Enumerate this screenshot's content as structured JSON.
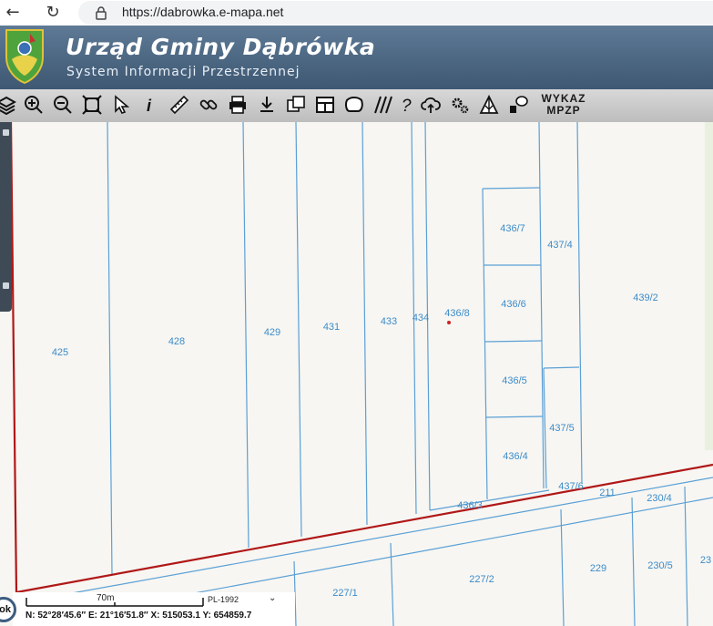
{
  "browser": {
    "url": "https://dabrowka.e-mapa.net"
  },
  "header": {
    "title": "Urząd Gminy Dąbrówka",
    "subtitle": "System Informacji Przestrzennej"
  },
  "toolbar": {
    "tools": [
      "layers-icon",
      "zoom-in-icon",
      "zoom-out-icon",
      "zoom-extent-icon",
      "pointer-icon",
      "info-icon",
      "measure-distance-icon",
      "link-icon",
      "print-icon",
      "download-icon",
      "overview-icon",
      "layout-icon",
      "area-icon",
      "hatch-icon",
      "help-icon",
      "cloud-upload-icon",
      "settings-icon",
      "terrain-icon",
      "comment-icon"
    ],
    "wykaz_line1": "WYKAZ",
    "wykaz_line2": "MPZP"
  },
  "map": {
    "parcels": [
      "425",
      "428",
      "429",
      "431",
      "433",
      "434",
      "436/8",
      "436/7",
      "436/6",
      "436/5",
      "436/4",
      "437/4",
      "437/5",
      "437/6",
      "436/3",
      "439/2",
      "211",
      "230/4",
      "227/1",
      "227/2",
      "229",
      "230/5",
      "23"
    ],
    "colors": {
      "parcel_line": "#5ba0d6",
      "parcel_label": "#3d8cc9",
      "boundary": "#b01818",
      "marker": "#cc2222"
    }
  },
  "scale": {
    "label": "70m",
    "crs": "PL-1992",
    "coords": "N: 52°28′45.6″   E: 21°16′51.8″   X: 515053.1   Y: 654859.7"
  },
  "ok_label": "ok"
}
